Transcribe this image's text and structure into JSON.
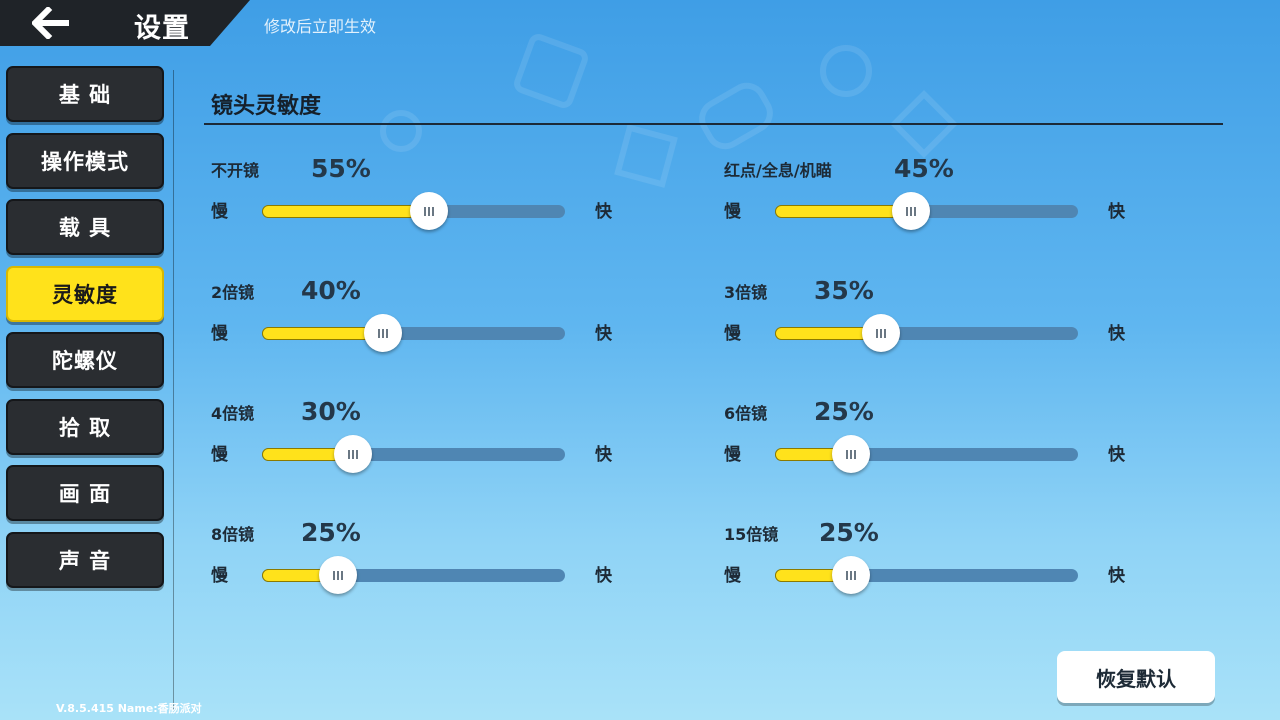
{
  "header": {
    "title": "设置",
    "hint": "修改后立即生效"
  },
  "sidebar": {
    "items": [
      {
        "label": "基 础",
        "active": false
      },
      {
        "label": "操作模式",
        "active": false
      },
      {
        "label": "载 具",
        "active": false
      },
      {
        "label": "灵敏度",
        "active": true
      },
      {
        "label": "陀螺仪",
        "active": false
      },
      {
        "label": "拾 取",
        "active": false
      },
      {
        "label": "画 面",
        "active": false
      },
      {
        "label": "声 音",
        "active": false
      }
    ]
  },
  "section": {
    "title": "镜头灵敏度"
  },
  "slider_labels": {
    "slow": "慢",
    "fast": "快"
  },
  "settings": [
    {
      "label": "不开镜",
      "value": "55%",
      "percent": 55
    },
    {
      "label": "红点/全息/机瞄",
      "value": "45%",
      "percent": 45
    },
    {
      "label": "2倍镜",
      "value": "40%",
      "percent": 40
    },
    {
      "label": "3倍镜",
      "value": "35%",
      "percent": 35
    },
    {
      "label": "4倍镜",
      "value": "30%",
      "percent": 30
    },
    {
      "label": "6倍镜",
      "value": "25%",
      "percent": 25
    },
    {
      "label": "8倍镜",
      "value": "25%",
      "percent": 25
    },
    {
      "label": "15倍镜",
      "value": "25%",
      "percent": 25
    }
  ],
  "reset_button": {
    "label": "恢复默认"
  },
  "footer": {
    "version": "V.8.5.415 Name:香肠派对"
  },
  "colors": {
    "accent": "#ffe21b",
    "nav_bg": "#2a2d31",
    "track": "#4f86b3"
  },
  "icons": {
    "back": "arrow-left-icon",
    "thumb": "grip-icon"
  }
}
